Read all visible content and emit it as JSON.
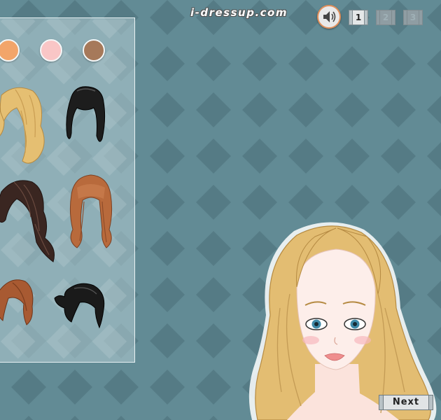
{
  "header": {
    "logo_text": "i-dressup.com",
    "sound_icon": "speaker-icon",
    "pages": [
      {
        "label": "1",
        "active": true
      },
      {
        "label": "2",
        "active": false
      },
      {
        "label": "3",
        "active": false
      }
    ]
  },
  "panel": {
    "skin_swatches": [
      {
        "name": "peach",
        "color": "#f2a56a"
      },
      {
        "name": "pink",
        "color": "#f9c6c6"
      },
      {
        "name": "tan",
        "color": "#a6795a"
      }
    ],
    "hair_options": [
      {
        "id": "blonde-wavy",
        "color": "#e8c27a"
      },
      {
        "id": "black-updo",
        "color": "#1d1d1d"
      },
      {
        "id": "dark-brown-long",
        "color": "#3a2621"
      },
      {
        "id": "auburn-bangs",
        "color": "#b86a3c"
      },
      {
        "id": "auburn-short",
        "color": "#a85a32"
      },
      {
        "id": "black-ponytail",
        "color": "#1a1a1a"
      }
    ]
  },
  "footer": {
    "next_label": "Next"
  },
  "colors": {
    "background": "#628b95",
    "diamond": "#557b85",
    "panel_border": "#e8f2f4"
  }
}
